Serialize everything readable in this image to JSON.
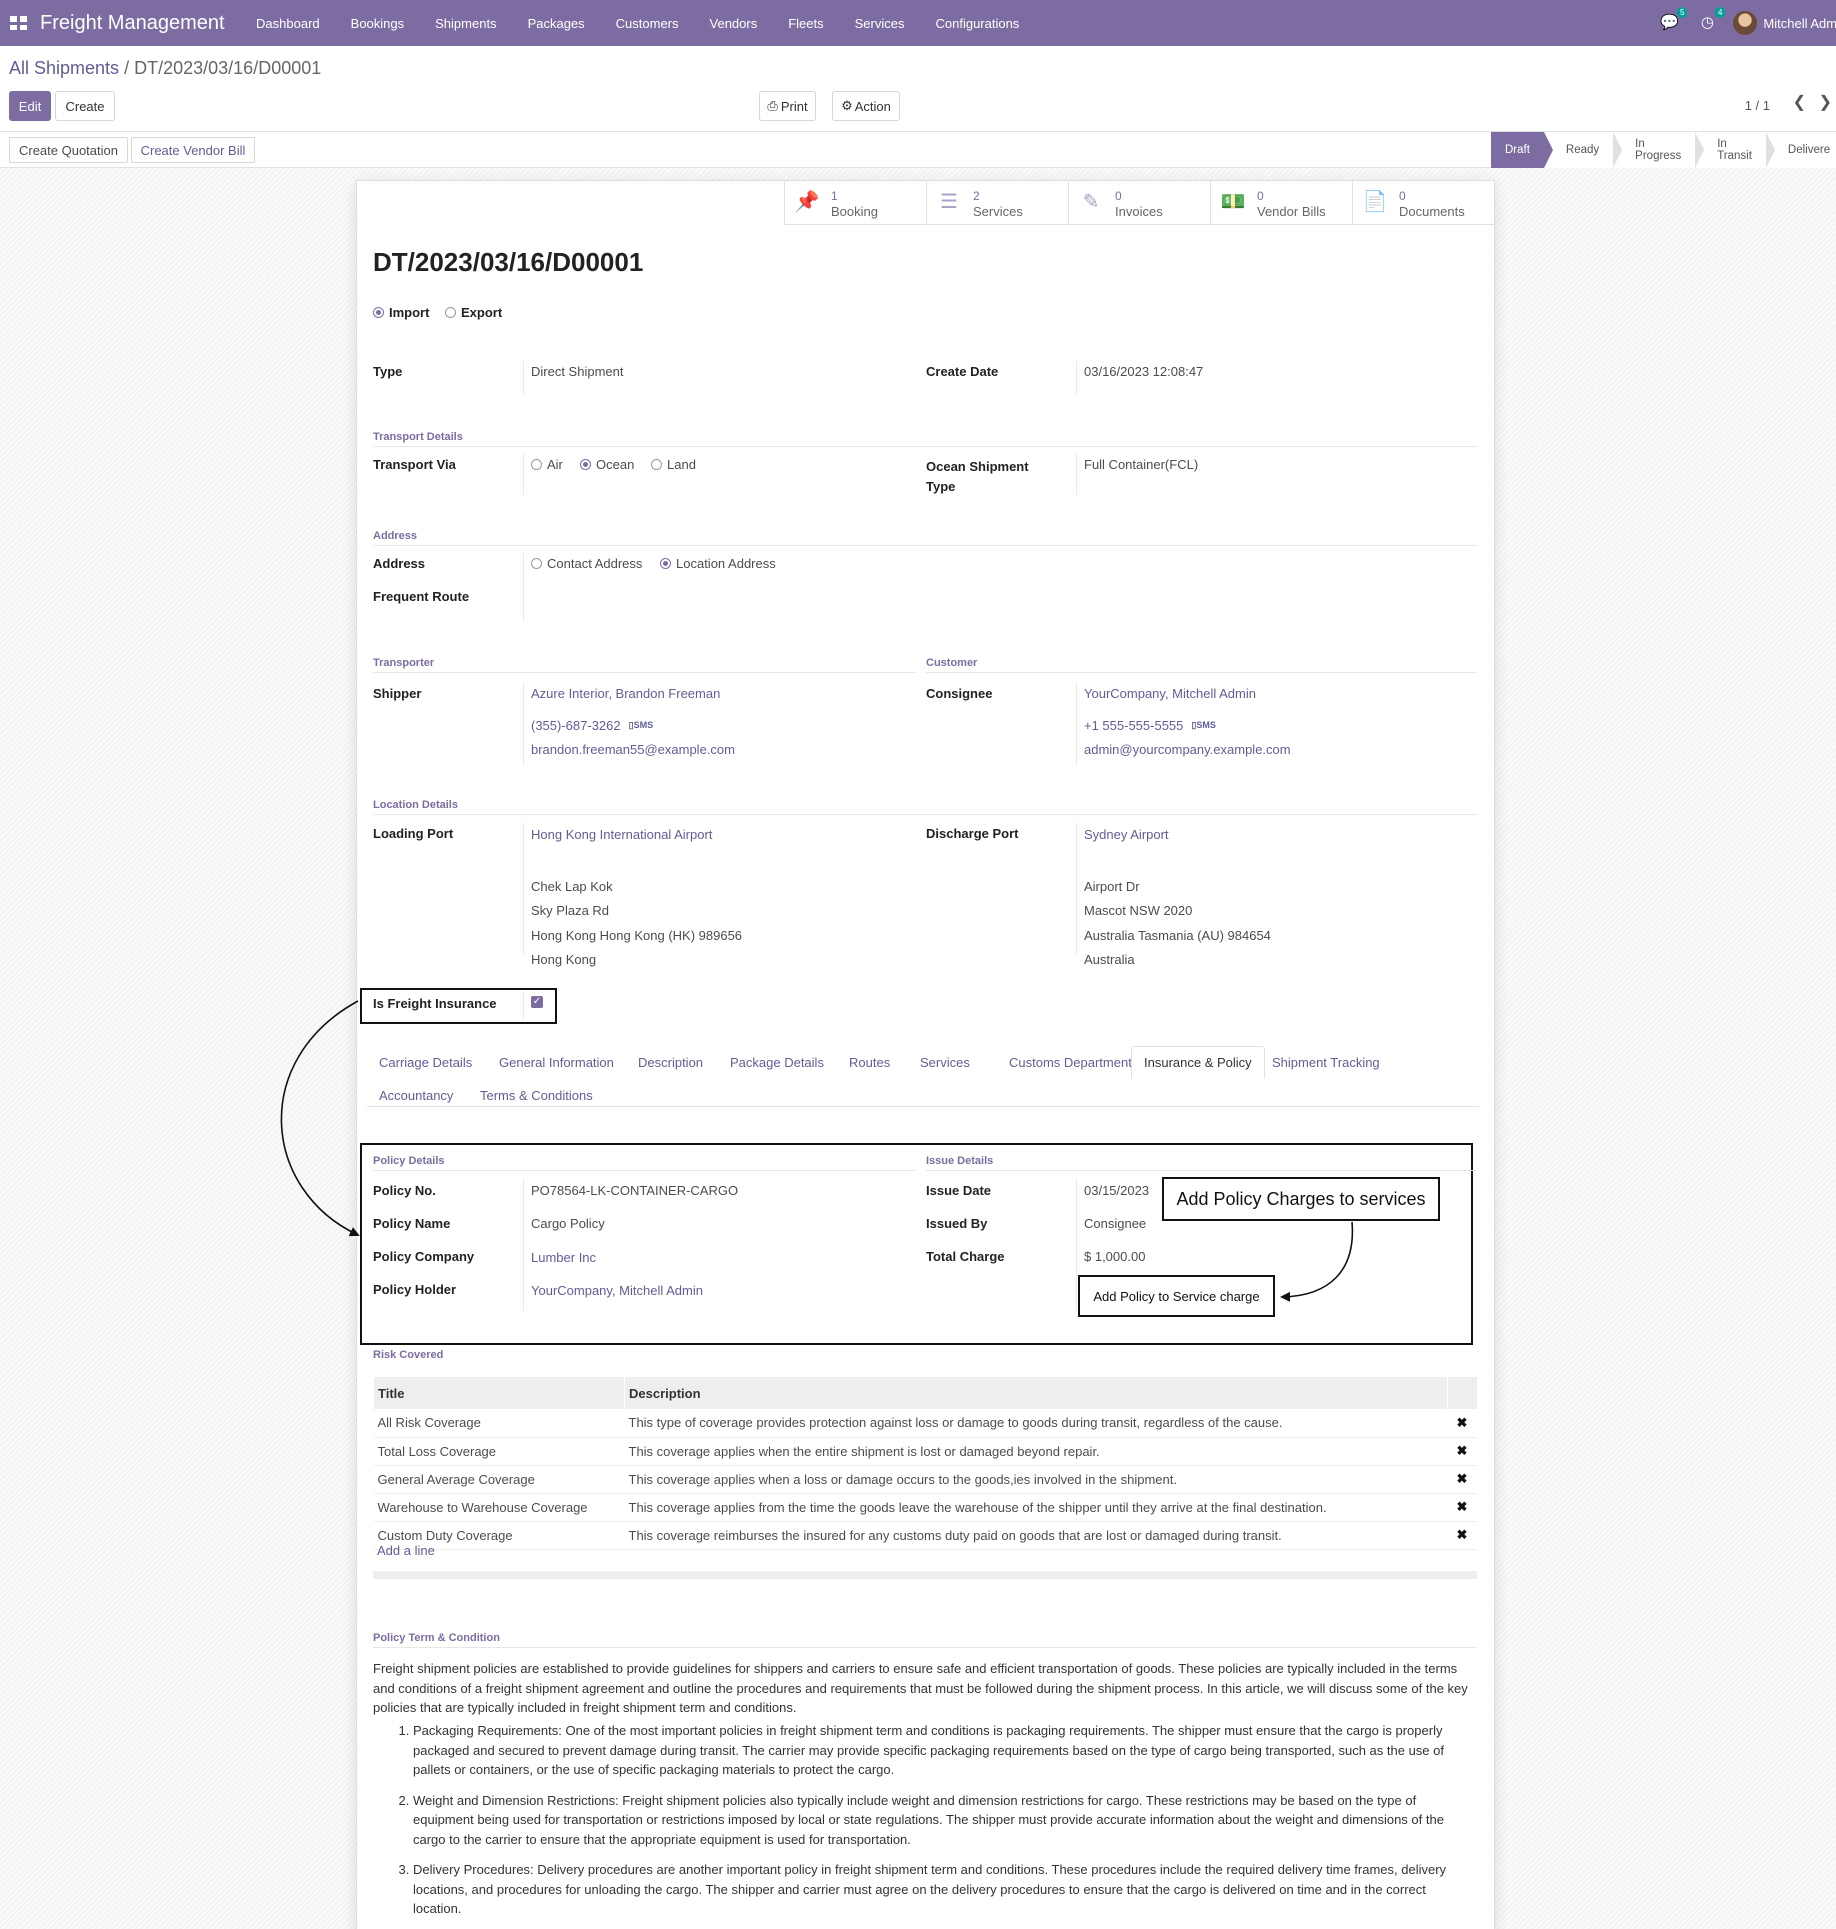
{
  "app": {
    "brand": "Freight Management",
    "menu": [
      "Dashboard",
      "Bookings",
      "Shipments",
      "Packages",
      "Customers",
      "Vendors",
      "Fleets",
      "Services",
      "Configurations"
    ],
    "messages_count": "5",
    "activities_count": "4",
    "user": "Mitchell Admi",
    "accent": "#7c6ca1"
  },
  "breadcrumb": {
    "parent": "All Shipments",
    "separator": "/",
    "current": "DT/2023/03/16/D00001"
  },
  "buttons": {
    "edit": "Edit",
    "create": "Create",
    "print": "Print",
    "action": "Action",
    "create_quotation": "Create Quotation",
    "create_vendor_bill": "Create Vendor Bill"
  },
  "pager": "1 / 1",
  "stages": [
    {
      "label": "Draft",
      "active": true
    },
    {
      "label": "Ready",
      "active": false
    },
    {
      "label": "In Progress",
      "active": false
    },
    {
      "label": "In Transit",
      "active": false
    },
    {
      "label": "Delivere",
      "active": false
    }
  ],
  "smart_buttons": [
    {
      "count": "1",
      "label": "Booking",
      "icon": "pin-icon"
    },
    {
      "count": "2",
      "label": "Services",
      "icon": "server-icon"
    },
    {
      "count": "0",
      "label": "Invoices",
      "icon": "edit-icon"
    },
    {
      "count": "0",
      "label": "Vendor Bills",
      "icon": "money-icon"
    },
    {
      "count": "0",
      "label": "Documents",
      "icon": "file-icon"
    }
  ],
  "record": {
    "name": "DT/2023/03/16/D00001",
    "direction": {
      "import": "Import",
      "export": "Export",
      "selected": "Import"
    },
    "type_label": "Type",
    "type": "Direct Shipment",
    "create_date_label": "Create Date",
    "create_date": "03/16/2023 12:08:47",
    "transport_section": "Transport Details",
    "transport_via_label": "Transport Via",
    "transport_options": [
      "Air",
      "Ocean",
      "Land"
    ],
    "transport_selected": "Ocean",
    "ocean_type_label": "Ocean Shipment Type",
    "ocean_type_label_1": "Ocean Shipment",
    "ocean_type_label_2": "Type",
    "ocean_type": "Full Container(FCL)",
    "address_section": "Address",
    "address_label": "Address",
    "address_options": [
      "Contact Address",
      "Location Address"
    ],
    "address_selected": "Location Address",
    "frequent_route_label": "Frequent Route",
    "transporter_section": "Transporter",
    "customer_section": "Customer",
    "shipper_label": "Shipper",
    "shipper": {
      "name": "Azure Interior, Brandon Freeman",
      "phone": "(355)-687-3262",
      "sms": "SMS",
      "email": "brandon.freeman55@example.com"
    },
    "consignee_label": "Consignee",
    "consignee": {
      "name": "YourCompany, Mitchell Admin",
      "phone": "+1 555-555-5555",
      "sms": "SMS",
      "email": "admin@yourcompany.example.com"
    },
    "location_section": "Location Details",
    "loading_port_label": "Loading Port",
    "loading_port": "Hong Kong International Airport",
    "loading_address": [
      "Chek Lap Kok",
      "Sky Plaza Rd",
      "Hong Kong  Hong Kong (HK)  989656",
      "Hong Kong"
    ],
    "discharge_port_label": "Discharge Port",
    "discharge_port": "Sydney Airport",
    "discharge_address": [
      "Airport Dr",
      "Mascot NSW 2020",
      "Australia  Tasmania (AU)  984654",
      "Australia"
    ],
    "freight_insurance_label": "Is Freight Insurance",
    "freight_insurance": true
  },
  "tabs": [
    {
      "label": "Carriage Details",
      "active": false
    },
    {
      "label": "General Information",
      "active": false
    },
    {
      "label": "Description",
      "active": false
    },
    {
      "label": "Package Details",
      "active": false
    },
    {
      "label": "Routes",
      "active": false
    },
    {
      "label": "Services",
      "active": false
    },
    {
      "label": "Customs Department",
      "active": false
    },
    {
      "label": "Insurance & Policy",
      "active": true
    },
    {
      "label": "Shipment Tracking",
      "active": false
    },
    {
      "label": "Accountancy",
      "active": false
    },
    {
      "label": "Terms & Conditions",
      "active": false
    }
  ],
  "policy": {
    "section": "Policy Details",
    "no_label": "Policy No.",
    "no": "PO78564-LK-CONTAINER-CARGO",
    "name_label": "Policy Name",
    "name": "Cargo Policy",
    "company_label": "Policy Company",
    "company": "Lumber Inc",
    "holder_label": "Policy Holder",
    "holder": "YourCompany, Mitchell Admin",
    "issue_section": "Issue Details",
    "issue_date_label": "Issue Date",
    "issue_date": "03/15/2023",
    "issued_by_label": "Issued By",
    "issued_by": "Consignee",
    "total_charge_label": "Total Charge",
    "total_charge": "$ 1,000.00",
    "add_button": "Add Policy to Service charge",
    "callout": "Add Policy Charges to services"
  },
  "risk": {
    "section": "Risk Covered",
    "columns": [
      "Title",
      "Description"
    ],
    "rows": [
      {
        "title": "All Risk Coverage",
        "description": "This type of coverage provides protection against loss or damage to goods during transit, regardless of the cause."
      },
      {
        "title": "Total Loss Coverage",
        "description": "This coverage applies when the entire shipment is lost or damaged beyond repair."
      },
      {
        "title": "General Average Coverage",
        "description": "This coverage applies when a loss or damage occurs to the goods,ies involved in the shipment."
      },
      {
        "title": "Warehouse to Warehouse Coverage",
        "description": "This coverage applies from the time the goods leave the warehouse of the shipper until they arrive at the final destination."
      },
      {
        "title": "Custom Duty Coverage",
        "description": "This coverage reimburses the insured for any customs duty paid on goods that are lost or damaged during transit."
      }
    ],
    "add_line": "Add a line"
  },
  "terms": {
    "section": "Policy Term & Condition",
    "intro": "Freight shipment policies are established to provide guidelines for shippers and carriers to ensure safe and efficient transportation of goods. These policies are typically included in the terms and conditions of a freight shipment agreement and outline the procedures and requirements that must be followed during the shipment process. In this article, we will discuss some of the key policies that are typically included in freight shipment term and conditions.",
    "items": [
      "Packaging Requirements: One of the most important policies in freight shipment term and conditions is packaging requirements. The shipper must ensure that the cargo is properly packaged and secured to prevent damage during transit. The carrier may provide specific packaging requirements based on the type of cargo being transported, such as the use of pallets or containers, or the use of specific packaging materials to protect the cargo.",
      "Weight and Dimension Restrictions: Freight shipment policies also typically include weight and dimension restrictions for cargo. These restrictions may be based on the type of equipment being used for transportation or restrictions imposed by local or state regulations. The shipper must provide accurate information about the weight and dimensions of the cargo to the carrier to ensure that the appropriate equipment is used for transportation.",
      "Delivery Procedures: Delivery procedures are another important policy in freight shipment term and conditions. These procedures include the required delivery time frames, delivery locations, and procedures for unloading the cargo. The shipper and carrier must agree on the delivery procedures to ensure that the cargo is delivered on time and in the correct location."
    ]
  }
}
